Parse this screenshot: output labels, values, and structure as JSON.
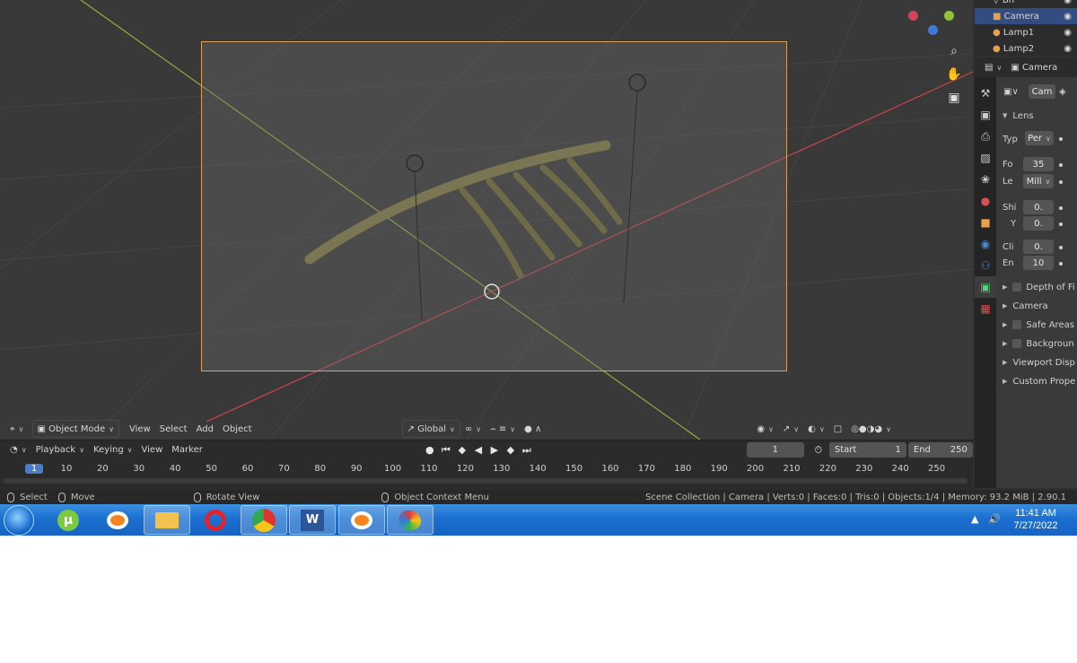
{
  "outliner": {
    "items": [
      {
        "label": "Bh",
        "selected": false
      },
      {
        "label": "Camera",
        "selected": true
      },
      {
        "label": "Lamp1",
        "selected": false
      },
      {
        "label": "Lamp2",
        "selected": false
      }
    ]
  },
  "properties": {
    "header_label": "Camera",
    "data_name": "Cam",
    "lens_panel": "Lens",
    "type_label": "Typ",
    "type_value": "Per",
    "focal_label": "Fo",
    "focal_value": "35",
    "lens_unit_label": "Le",
    "lens_unit_value": "Mill",
    "shift_x_label": "Shi",
    "shift_x_value": "0.",
    "shift_y_label": "Y",
    "shift_y_value": "0.",
    "clip_start_label": "Cli",
    "clip_start_value": "0.",
    "clip_end_label": "En",
    "clip_end_value": "10",
    "depth_of_field": "Depth of Fi",
    "camera_panel": "Camera",
    "safe_areas": "Safe Areas",
    "background": "Backgroun",
    "viewport_display": "Viewport Disp",
    "custom_props": "Custom Prope"
  },
  "viewport_header": {
    "mode": "Object Mode",
    "menu_view": "View",
    "menu_select": "Select",
    "menu_add": "Add",
    "menu_object": "Object",
    "transform_orientation": "Global"
  },
  "timeline": {
    "playback": "Playback",
    "keying": "Keying",
    "view": "View",
    "marker": "Marker",
    "current_frame": "1",
    "start_label": "Start",
    "start_value": "1",
    "end_label": "End",
    "end_value": "250",
    "ticks": [
      "1",
      "10",
      "20",
      "30",
      "40",
      "50",
      "60",
      "70",
      "80",
      "90",
      "100",
      "110",
      "120",
      "130",
      "140",
      "150",
      "160",
      "170",
      "180",
      "190",
      "200",
      "210",
      "220",
      "230",
      "240",
      "250"
    ]
  },
  "statusbar": {
    "select": "Select",
    "move": "Move",
    "rotate_view": "Rotate View",
    "context_menu": "Object Context Menu",
    "stats": "Scene Collection | Camera | Verts:0 | Faces:0 | Tris:0 | Objects:1/4 | Memory: 93.2 MiB | 2.90.1"
  },
  "taskbar": {
    "time": "11:41 AM",
    "date": "7/27/2022",
    "apps": [
      "utorrent-icon",
      "blender-icon",
      "file-explorer-icon",
      "opera-icon",
      "chrome-icon",
      "word-icon",
      "blender-icon",
      "paint-icon"
    ]
  },
  "colors": {
    "x_axis": "#c8454a",
    "y_axis": "#8fb03a",
    "camera_frame": "#d9a25a",
    "selection": "#334d80",
    "taskbar": "#1c6fd0"
  }
}
